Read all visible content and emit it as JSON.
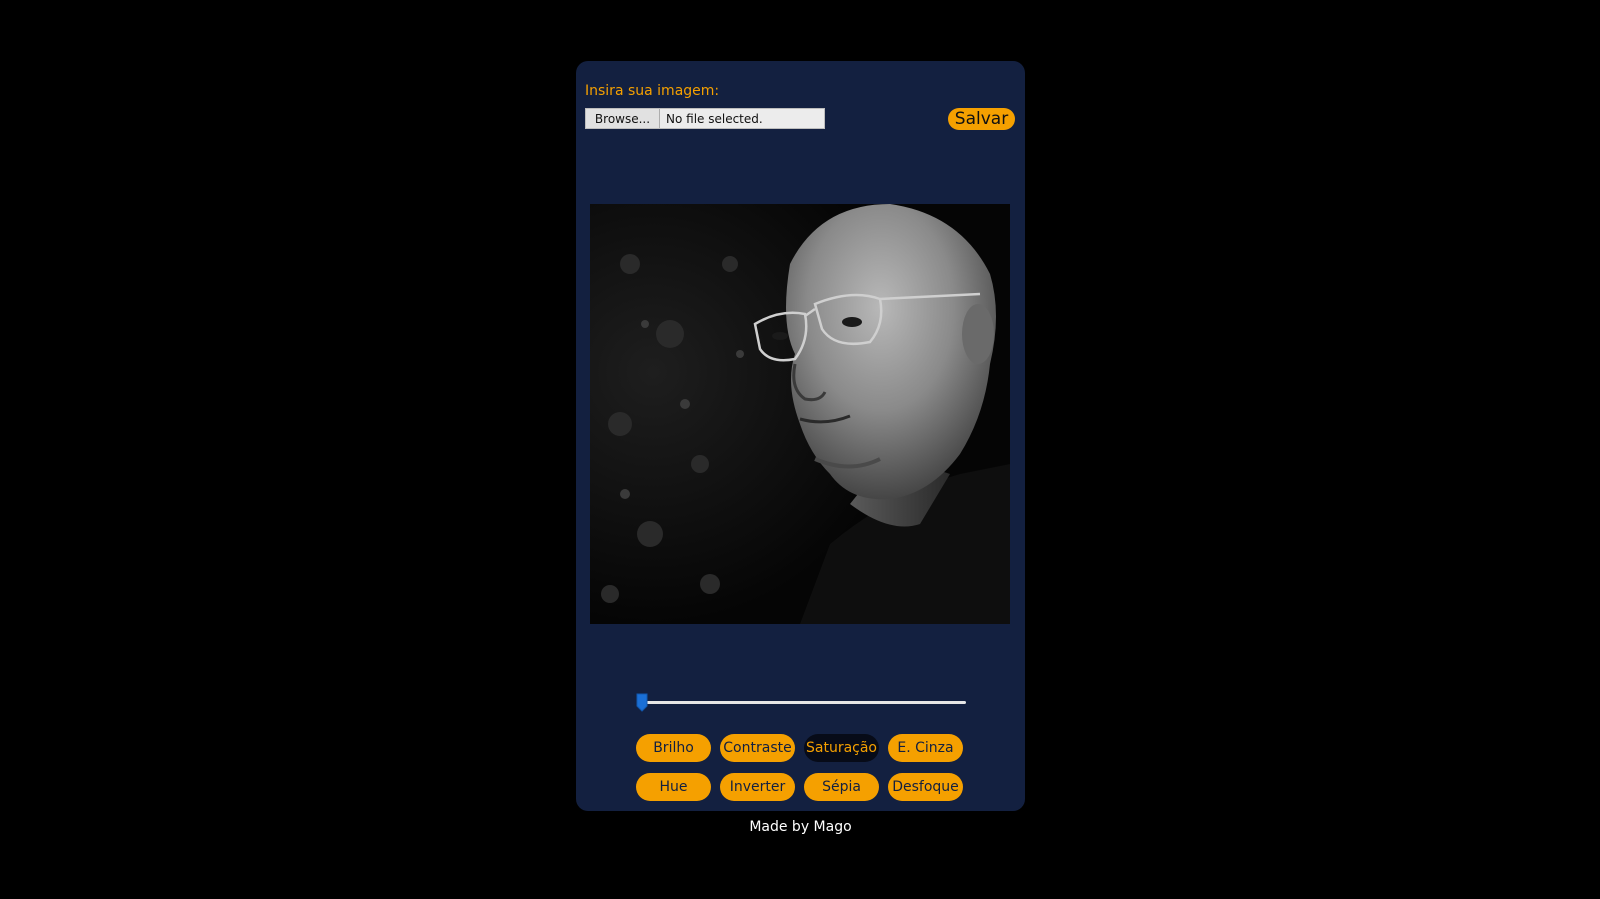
{
  "upload": {
    "label": "Insira sua imagem:",
    "browse_label": "Browse...",
    "status": "No file selected."
  },
  "save_label": "Salvar",
  "slider": {
    "value_fraction": 0.0
  },
  "filters": [
    {
      "label": "Brilho",
      "active": false
    },
    {
      "label": "Contraste",
      "active": false
    },
    {
      "label": "Saturação",
      "active": true
    },
    {
      "label": "E. Cinza",
      "active": false
    },
    {
      "label": "Hue",
      "active": false
    },
    {
      "label": "Inverter",
      "active": false
    },
    {
      "label": "Sépia",
      "active": false
    },
    {
      "label": "Desfoque",
      "active": false
    }
  ],
  "footer": "Made by Mago",
  "colors": {
    "page_bg": "#000000",
    "panel_bg": "#132040",
    "accent": "#f5a000",
    "active_bg": "#070b18",
    "slider_thumb": "#1a6fd6"
  }
}
